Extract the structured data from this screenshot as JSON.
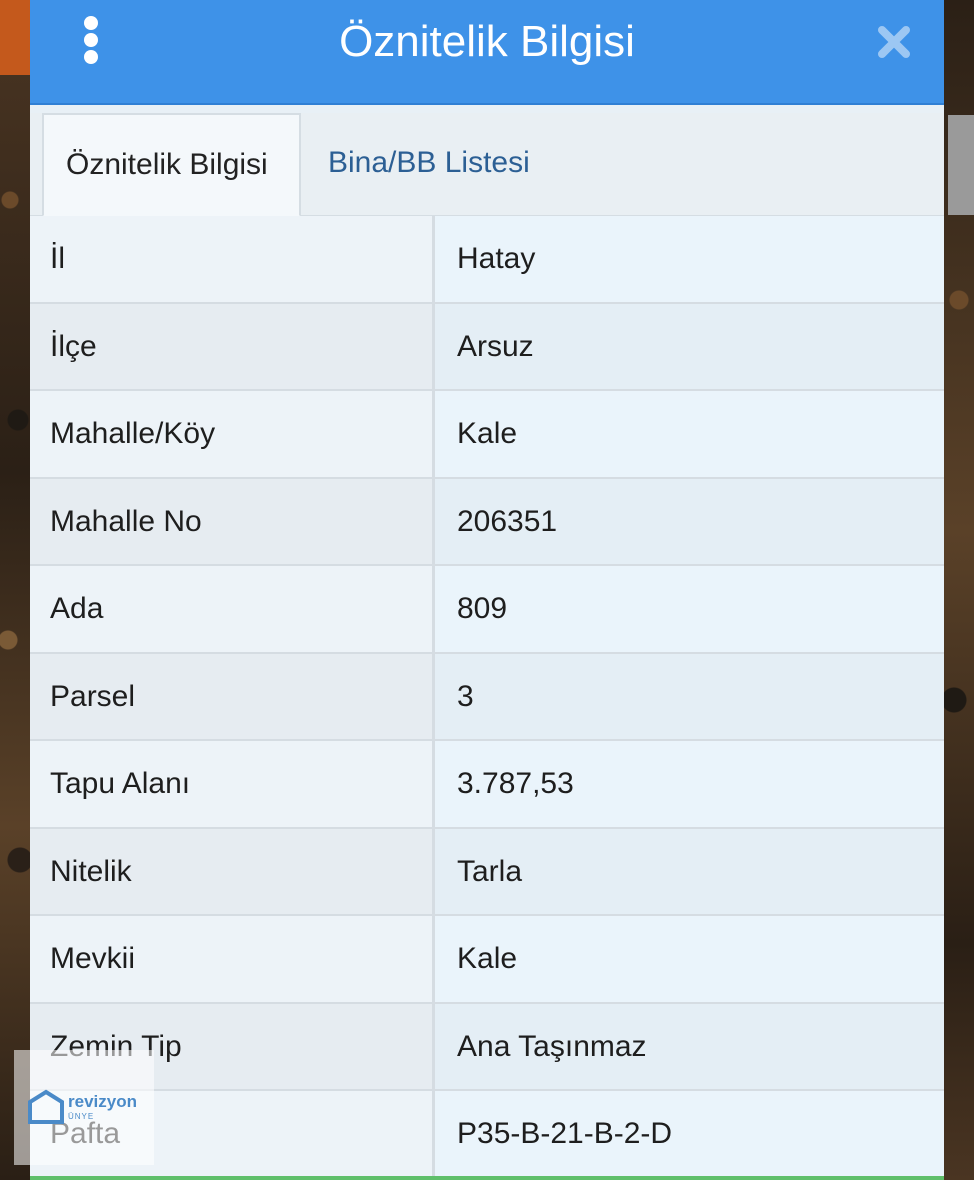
{
  "header": {
    "title": "Öznitelik Bilgisi"
  },
  "tabs": [
    {
      "label": "Öznitelik Bilgisi",
      "active": true
    },
    {
      "label": "Bina/BB Listesi",
      "active": false
    }
  ],
  "rows": [
    {
      "key": "İl",
      "value": "Hatay"
    },
    {
      "key": "İlçe",
      "value": "Arsuz"
    },
    {
      "key": "Mahalle/Köy",
      "value": "Kale"
    },
    {
      "key": "Mahalle No",
      "value": "206351"
    },
    {
      "key": "Ada",
      "value": "809"
    },
    {
      "key": "Parsel",
      "value": "3"
    },
    {
      "key": "Tapu Alanı",
      "value": "3.787,53"
    },
    {
      "key": "Nitelik",
      "value": "Tarla"
    },
    {
      "key": "Mevkii",
      "value": "Kale"
    },
    {
      "key": "Zemin Tip",
      "value": "Ana Taşınmaz"
    },
    {
      "key": "Pafta",
      "value": "P35-B-21-B-2-D"
    }
  ],
  "logo": {
    "name": "revizyon",
    "sub": "ÜNYE"
  },
  "colors": {
    "header": "#3e92e8",
    "tab_link": "#2c5f94"
  }
}
